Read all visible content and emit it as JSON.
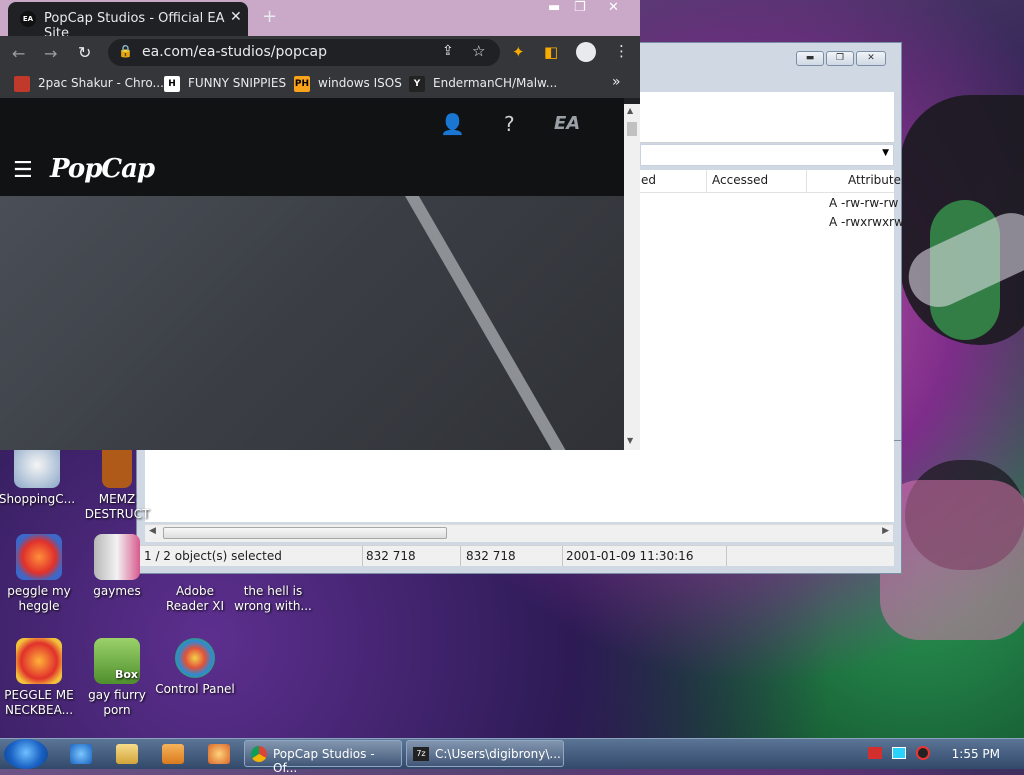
{
  "chrome": {
    "tab_title": "PopCap Studios - Official EA Site",
    "favicon_text": "EA",
    "url": "ea.com/ea-studios/popcap",
    "bookmarks": [
      "2pac Shakur - Chro...",
      "FUNNY SNIPPIES",
      "windows ISOS",
      "EndermanCH/Malw..."
    ],
    "bookmark_more": "»",
    "site_logo": "PopCap",
    "ea_logo": "EA"
  },
  "archive": {
    "columns": [
      "ed",
      "Accessed",
      "Attribute"
    ],
    "rows": [
      "A -rw-rw-rw",
      "A -rwxrwxrw"
    ],
    "status": [
      "1 / 2 object(s) selected",
      "832 718",
      "832 718",
      "2001-01-09 11:30:16"
    ]
  },
  "desktop": {
    "icons": [
      "ShoppingC...",
      "MEMZ DESTRUCT",
      "peggle my heggle",
      "gaymes",
      "Adobe Reader XI",
      "the hell is wrong with...",
      "PEGGLE ME NECKBEA...",
      "gay fiurry porn",
      "Control Panel"
    ],
    "box_label": "Box"
  },
  "taskbar": {
    "items": [
      "PopCap Studios - Of...",
      "C:\\Users\\digibrony\\..."
    ],
    "clock": "1:55 PM"
  }
}
